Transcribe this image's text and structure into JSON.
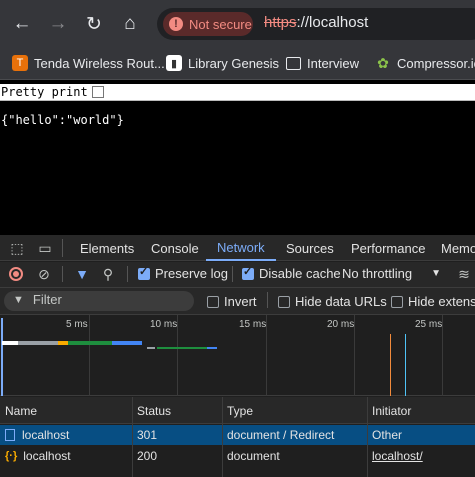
{
  "browser": {
    "security_label": "Not secure",
    "url_proto": "https",
    "url_rest": "://localhost"
  },
  "bookmarks": [
    {
      "label": "Tenda Wireless Rout...",
      "icon": "tenda-icon"
    },
    {
      "label": "Library Genesis",
      "icon": "book-icon"
    },
    {
      "label": "Interview",
      "icon": "folder-icon"
    },
    {
      "label": "Compressor.io",
      "icon": "frog-icon"
    }
  ],
  "page": {
    "pretty_print_label": "Pretty print",
    "json_text": "{\"hello\":\"world\"}"
  },
  "devtools": {
    "tabs": [
      "Elements",
      "Console",
      "Network",
      "Sources",
      "Performance",
      "Memo"
    ],
    "active_tab": "Network",
    "toolbar": {
      "preserve_log": "Preserve log",
      "disable_cache": "Disable cache",
      "throttling": "No throttling"
    },
    "filter": {
      "placeholder": "Filter",
      "invert": "Invert",
      "hide_data_urls": "Hide data URLs",
      "hide_extension": "Hide extensi"
    },
    "timeline_ticks": [
      "5 ms",
      "10 ms",
      "15 ms",
      "20 ms",
      "25 ms"
    ],
    "columns": [
      "Name",
      "Status",
      "Type",
      "Initiator"
    ],
    "rows": [
      {
        "name": "localhost",
        "status": "301",
        "type": "document / Redirect",
        "initiator": "Other",
        "selected": true
      },
      {
        "name": "localhost",
        "status": "200",
        "type": "document",
        "initiator": "localhost/",
        "selected": false
      }
    ]
  },
  "colors": {
    "accent": "#7cacf8",
    "warning": "#f28b82",
    "selected_row": "#074e83"
  }
}
